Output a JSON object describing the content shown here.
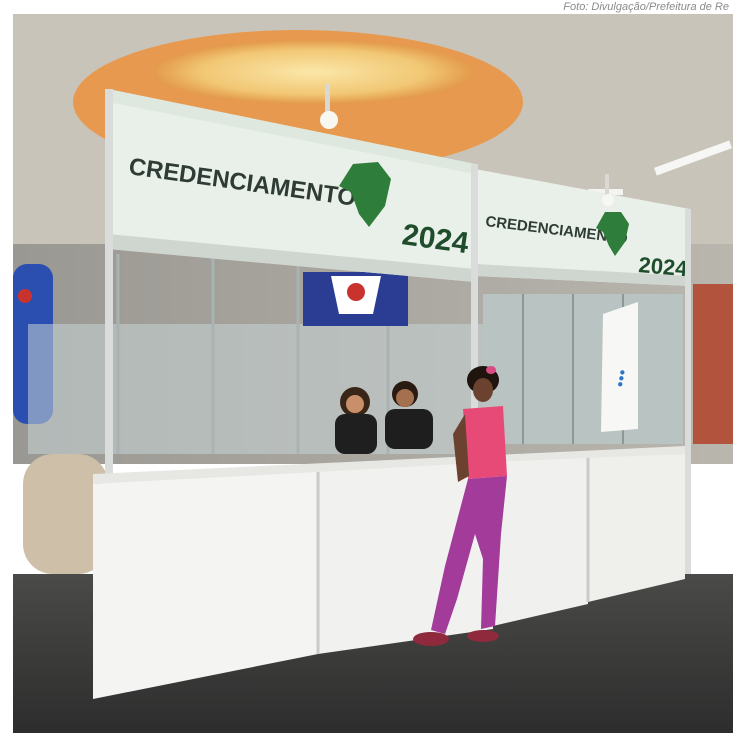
{
  "photo_credit": "Foto: Divulgação/Prefeitura de Re",
  "banner": {
    "title": "CREDENCIAMENTO",
    "year": "2024"
  },
  "colors": {
    "ceiling": "#c8c3b8",
    "skylight_ring": "#e79a4f",
    "skylight_glow": "#f5d68a",
    "banner_bg": "#e9efe9",
    "map_green": "#2e7d3a",
    "counter": "#f4f4f2",
    "floor": "#3b3b3b",
    "shirt": "#e84a78",
    "pants": "#a23b9a"
  }
}
